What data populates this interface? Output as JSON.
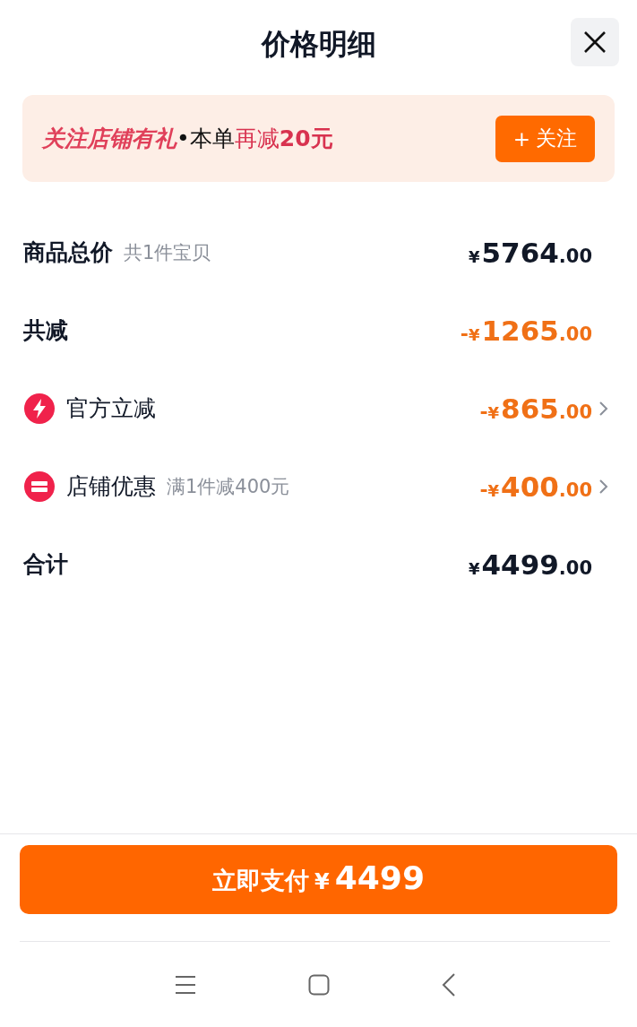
{
  "title": "价格明细",
  "banner": {
    "segments": [
      {
        "kind": "brand",
        "text": "关注店铺有礼"
      },
      {
        "kind": "plain",
        "text": "•本单"
      },
      {
        "kind": "accent",
        "text": "再减"
      },
      {
        "kind": "accent-bold",
        "text": "20元"
      }
    ],
    "button": {
      "icon": "+",
      "label": "关注"
    }
  },
  "rows": [
    {
      "kind": "total",
      "label": "商品总价",
      "note": "共1件宝贝",
      "price": {
        "currency": "¥",
        "whole": "5764",
        "cents": ".00"
      }
    },
    {
      "kind": "reduction",
      "label": "共减",
      "price": {
        "sign": "-",
        "currency": "¥",
        "whole": "1265",
        "cents": ".00"
      }
    },
    {
      "kind": "official-discount",
      "label": "官方立减",
      "price": {
        "sign": "-",
        "currency": "¥",
        "whole": "865",
        "cents": ".00"
      }
    },
    {
      "kind": "shop-discount",
      "label": "店铺优惠",
      "note": "满1件减400元",
      "price": {
        "sign": "-",
        "currency": "¥",
        "whole": "400",
        "cents": ".00"
      }
    },
    {
      "kind": "total",
      "label": "合计",
      "price": {
        "currency": "¥",
        "whole": "4499",
        "cents": ".00"
      }
    }
  ],
  "pay_button": {
    "label": "立即支付",
    "currency": "¥",
    "amount": "4499"
  }
}
